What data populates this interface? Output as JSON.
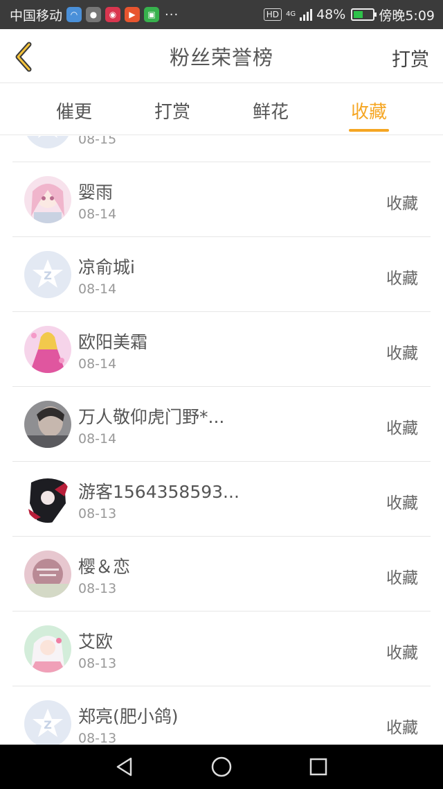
{
  "status_bar": {
    "carrier": "中国移动",
    "more": "···",
    "hd": "HD",
    "network": "4G",
    "battery": "48%",
    "battery_level": 0.48,
    "time": "傍晚5:09"
  },
  "header": {
    "title": "粉丝荣誉榜",
    "right_action": "打赏"
  },
  "tabs": [
    {
      "label": "催更",
      "active": false
    },
    {
      "label": "打赏",
      "active": false
    },
    {
      "label": "鲜花",
      "active": false
    },
    {
      "label": "收藏",
      "active": true
    }
  ],
  "colors": {
    "accent": "#f5a623",
    "status_bar": "#3b3b3b",
    "nav_bar": "#000000"
  },
  "rows": [
    {
      "name": "",
      "date": "08-15",
      "action": "",
      "avatar": "default-qq-avatar"
    },
    {
      "name": "婴雨",
      "date": "08-14",
      "action": "收藏",
      "avatar": "anime-pink-avatar"
    },
    {
      "name": "凉俞城i",
      "date": "08-14",
      "action": "收藏",
      "avatar": "default-qq-avatar"
    },
    {
      "name": "欧阳美霜",
      "date": "08-14",
      "action": "收藏",
      "avatar": "anime-pink-dress-avatar"
    },
    {
      "name": "万人敬仰虎门野*...",
      "date": "08-14",
      "action": "收藏",
      "avatar": "photo-avatar"
    },
    {
      "name": "游客1564358593...",
      "date": "08-13",
      "action": "收藏",
      "avatar": "dark-anime-avatar"
    },
    {
      "name": "樱＆恋",
      "date": "08-13",
      "action": "收藏",
      "avatar": "pink-photo-avatar"
    },
    {
      "name": "艾欧",
      "date": "08-13",
      "action": "收藏",
      "avatar": "anime-white-hair-avatar"
    },
    {
      "name": "郑亮(肥小鸽)",
      "date": "08-13",
      "action": "收藏",
      "avatar": "default-qq-avatar"
    }
  ]
}
